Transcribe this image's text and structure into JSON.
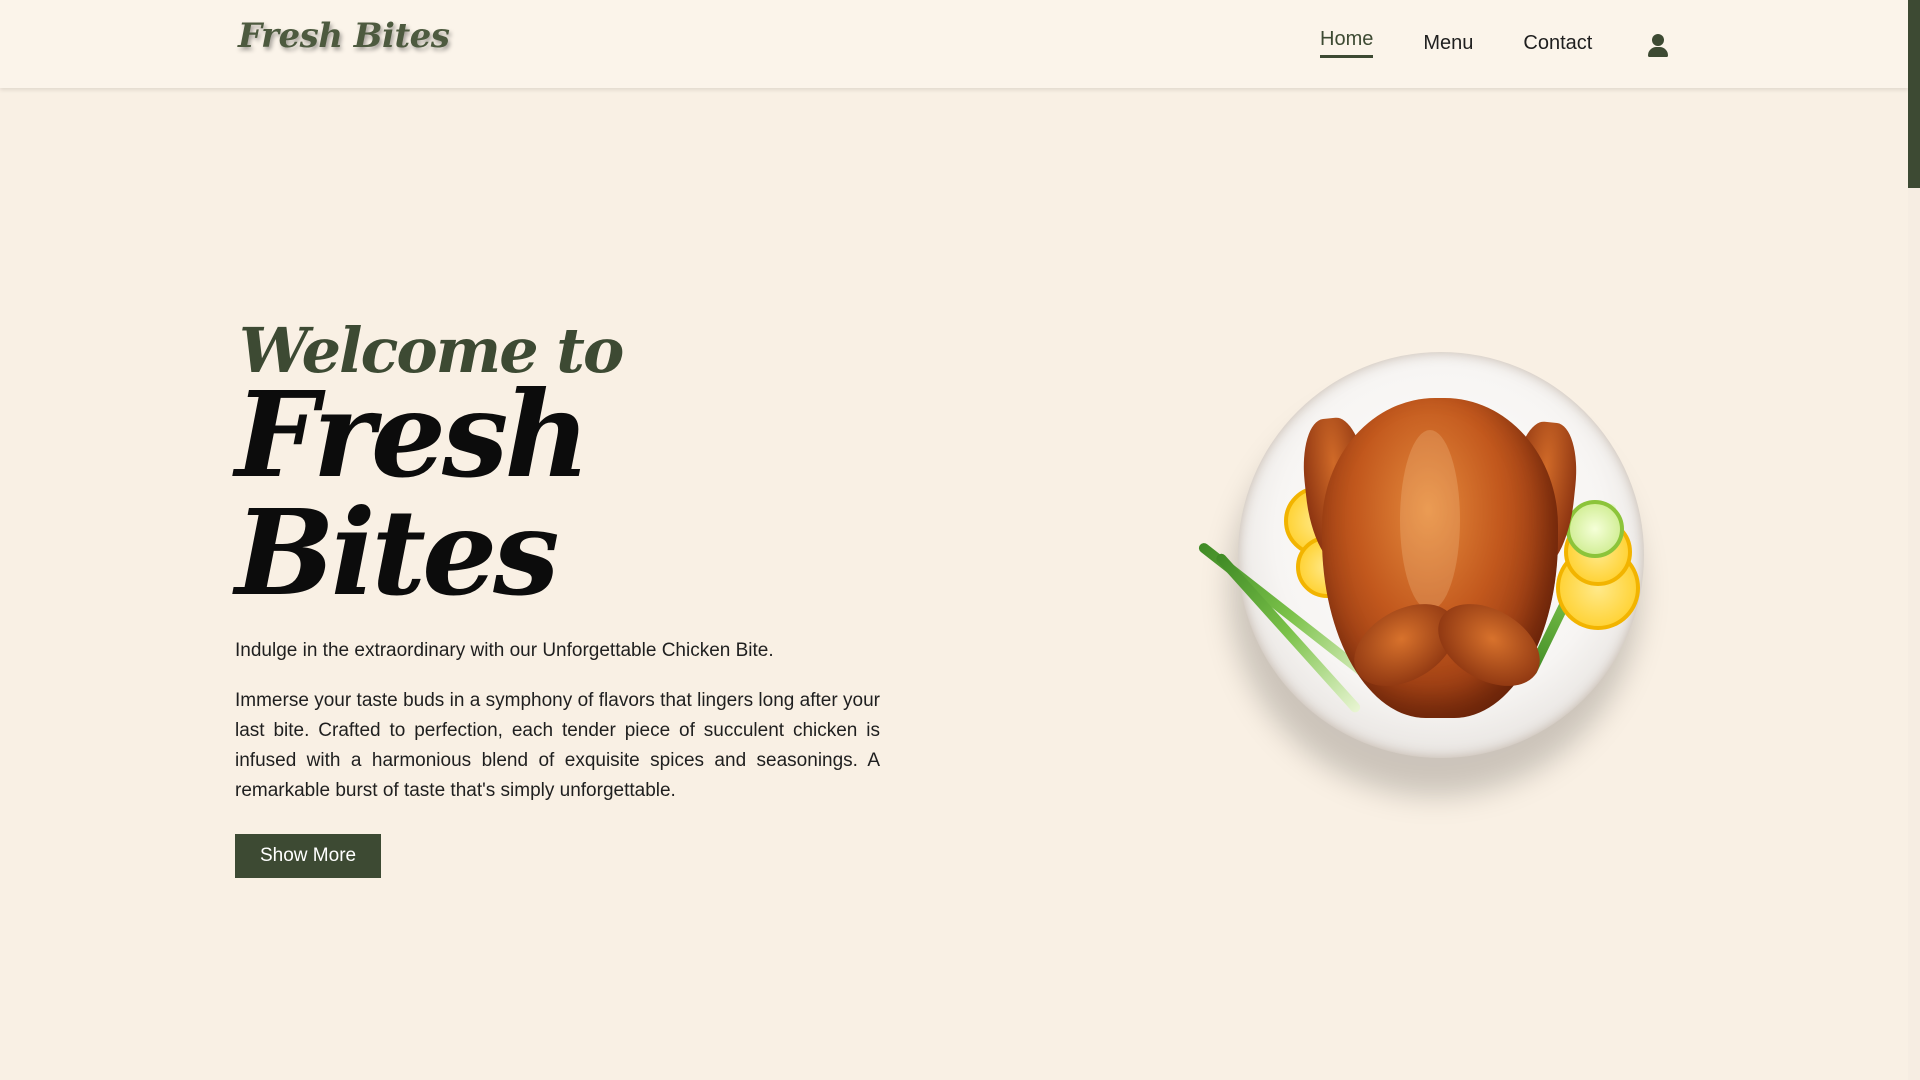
{
  "header": {
    "logo_text": "Fresh Bites",
    "nav": [
      {
        "label": "Home",
        "active": true
      },
      {
        "label": "Menu",
        "active": false
      },
      {
        "label": "Contact",
        "active": false
      }
    ],
    "user_icon": "user-icon"
  },
  "hero": {
    "welcome": "Welcome to",
    "brand": "Fresh Bites",
    "tagline": "Indulge in the extraordinary with our Unforgettable Chicken Bite.",
    "description": "Immerse your taste buds in a symphony of flavors that lingers long after your last bite. Crafted to perfection, each tender piece of succulent chicken is infused with a harmonious blend of exquisite spices and seasonings. A remarkable burst of taste that's simply unforgettable.",
    "button_label": "Show More"
  },
  "colors": {
    "background": "#f9f0e4",
    "accent": "#3d4a33",
    "button_text": "#ffffff"
  }
}
